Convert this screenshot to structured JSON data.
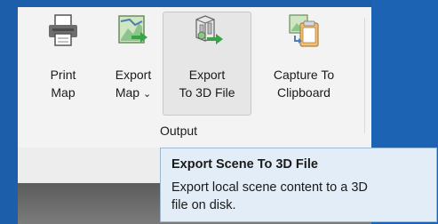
{
  "ribbon": {
    "buttons": [
      {
        "line1": "Print",
        "line2": "Map",
        "icon": "printer-icon"
      },
      {
        "line1": "Export",
        "line2": "Map",
        "dropdown": "⌄",
        "icon": "export-map-icon"
      },
      {
        "line1": "Export",
        "line2": "To 3D File",
        "icon": "export-3d-icon"
      },
      {
        "line1": "Capture To",
        "line2": "Clipboard",
        "icon": "clipboard-icon"
      }
    ],
    "group_label": "Output"
  },
  "tooltip": {
    "title": "Export Scene To 3D File",
    "body_line1": "Export local scene content to a 3D",
    "body_line2": "file on disk."
  },
  "colors": {
    "window_blue": "#1c5ea9",
    "ribbon_bg": "#f3f3f3",
    "tooltip_bg": "#e2edf7",
    "arrow_green": "#3aa34a"
  }
}
